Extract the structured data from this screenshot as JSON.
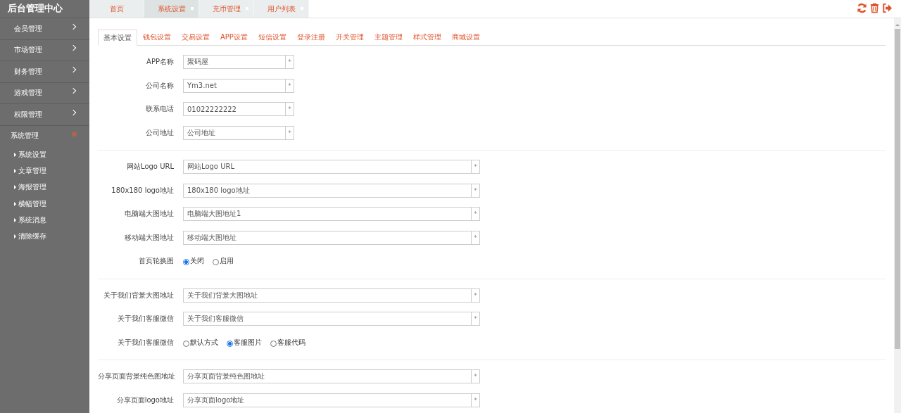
{
  "sidebar": {
    "title": "后台管理中心",
    "menu": [
      {
        "label": "会员管理",
        "expanded": false
      },
      {
        "label": "市场管理",
        "expanded": false
      },
      {
        "label": "财务管理",
        "expanded": false
      },
      {
        "label": "游戏管理",
        "expanded": false
      },
      {
        "label": "权限管理",
        "expanded": false
      },
      {
        "label": "系统管理",
        "expanded": true,
        "children": [
          {
            "label": "系统设置"
          },
          {
            "label": "文章管理"
          },
          {
            "label": "海报管理"
          },
          {
            "label": "横幅管理"
          },
          {
            "label": "系统消息"
          },
          {
            "label": "清除缓存"
          }
        ]
      }
    ]
  },
  "top_tabs": [
    {
      "label": "首页",
      "selected": false,
      "closable": false
    },
    {
      "label": "系统设置",
      "selected": true,
      "closable": true
    },
    {
      "label": "充币管理",
      "selected": false,
      "closable": true
    },
    {
      "label": "用户列表",
      "selected": false,
      "closable": true
    }
  ],
  "settings_tabs": [
    {
      "label": "基本设置",
      "selected": true
    },
    {
      "label": "钱包设置",
      "selected": false
    },
    {
      "label": "交易设置",
      "selected": false
    },
    {
      "label": "APP设置",
      "selected": false
    },
    {
      "label": "短信设置",
      "selected": false
    },
    {
      "label": "登录注册",
      "selected": false
    },
    {
      "label": "开关管理",
      "selected": false
    },
    {
      "label": "主题管理",
      "selected": false
    },
    {
      "label": "样式管理",
      "selected": false
    },
    {
      "label": "商城设置",
      "selected": false
    }
  ],
  "sections": [
    {
      "rows": [
        {
          "kind": "short-input",
          "label": "APP名称",
          "value": "聚码屋",
          "addon": "*"
        },
        {
          "kind": "short-input",
          "label": "公司名称",
          "value": "Ym3.net",
          "addon": "*"
        },
        {
          "kind": "short-input",
          "label": "联系电话",
          "value": "01022222222",
          "addon": "*"
        },
        {
          "kind": "short-input",
          "label": "公司地址",
          "value": "公司地址",
          "addon": "*"
        }
      ]
    },
    {
      "rows": [
        {
          "kind": "input",
          "label": "网站Logo URL",
          "value": "网站Logo URL",
          "addon": "*"
        },
        {
          "kind": "input",
          "label": "180x180 logo地址",
          "value": "180x180 logo地址",
          "addon": "*"
        },
        {
          "kind": "input",
          "label": "电脑端大图地址",
          "value": "电脑端大图地址1",
          "addon": "*"
        },
        {
          "kind": "input",
          "label": "移动端大图地址",
          "value": "移动端大图地址",
          "addon": "*"
        },
        {
          "kind": "radio",
          "label": "首页轮换图",
          "options": [
            {
              "label": "关闭",
              "selected": true
            },
            {
              "label": "启用",
              "selected": false
            }
          ]
        }
      ]
    },
    {
      "rows": [
        {
          "kind": "input",
          "label": "关于我们背景大图地址",
          "value": "关于我们背景大图地址",
          "addon": "*"
        },
        {
          "kind": "input",
          "label": "关于我们客服微信",
          "value": "关于我们客服微信",
          "addon": "*"
        },
        {
          "kind": "radio",
          "label": "关于我们客服微信",
          "options": [
            {
              "label": "默认方式",
              "selected": false
            },
            {
              "label": "客服图片",
              "selected": true
            },
            {
              "label": "客服代码",
              "selected": false
            }
          ]
        }
      ]
    },
    {
      "rows": [
        {
          "kind": "input",
          "label": "分享页面背景纯色图地址",
          "value": "分享页面背景纯色图地址",
          "addon": "*"
        },
        {
          "kind": "input",
          "label": "分享页面logo地址",
          "value": "分享页面logo地址",
          "addon": "*"
        }
      ]
    }
  ]
}
